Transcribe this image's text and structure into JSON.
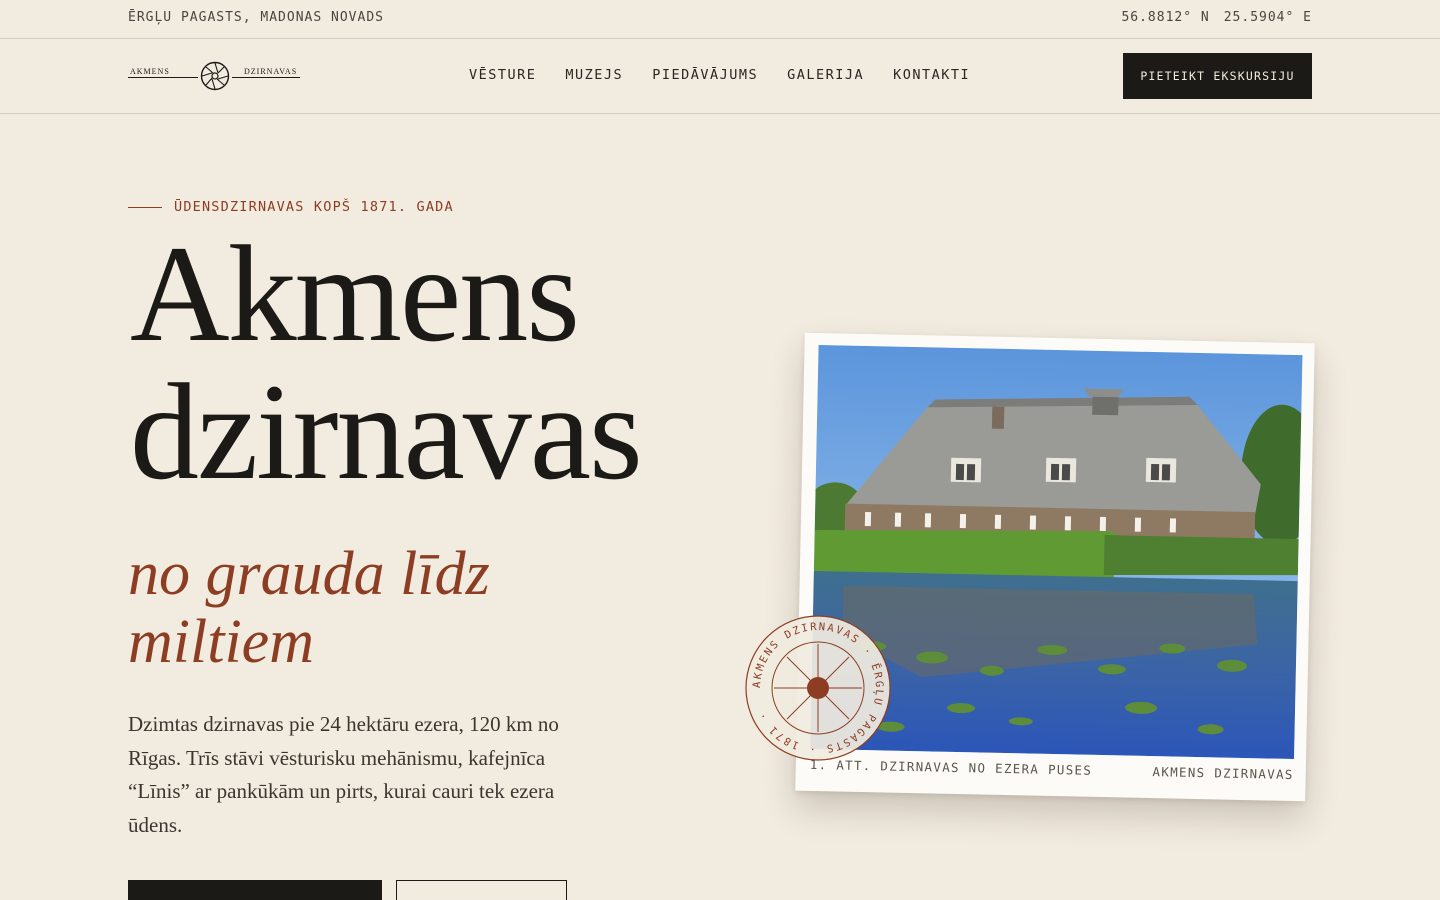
{
  "topbar": {
    "location": "ĒRGĻU PAGASTS, MADONAS NOVADS",
    "lat": "56.8812° N",
    "lon": "25.5904° E"
  },
  "logo": {
    "left": "AKMENS",
    "right": "DZIRNAVAS"
  },
  "nav": {
    "items": [
      "VĒSTURE",
      "MUZEJS",
      "PIEDĀVĀJUMS",
      "GALERIJA",
      "KONTAKTI"
    ],
    "cta": "PIETEIKT EKSKURSIJU"
  },
  "hero": {
    "eyebrow": "ŪDENSDZIRNAVAS KOPŠ 1871. GADA",
    "title_line1": "Akmens",
    "title_line2": "dzirnavas",
    "tagline_line1": "no grauda līdz",
    "tagline_line2": "miltiem",
    "lede": "Dzimtas dzirnavas pie 24 hektāru ezera, 120 km no Rīgas. Trīs stāvi vēsturisku mehānismu, kafejnīca “Līnis” ar pankūkām un pirts, kurai cauri tek ezera ūdens."
  },
  "figure": {
    "caption_left": "1. ATT. DZIRNAVAS NO EZERA PUSES",
    "caption_right": "AKMENS DZIRNAVAS"
  },
  "stamp": {
    "text": "AKMENS DZIRNAVAS · ĒRGĻU PAGASTS · 1871 ·"
  },
  "colors": {
    "background": "#f1ebe0",
    "ink": "#1c1a16",
    "accent": "#8d3e22"
  },
  "icons": {
    "logo_mark": "mill-wheel-icon",
    "stamp_mark": "mill-wheel-icon"
  }
}
